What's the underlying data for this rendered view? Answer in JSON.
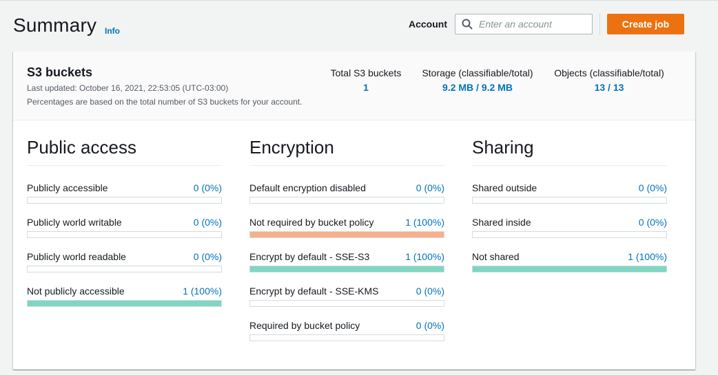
{
  "header": {
    "title": "Summary",
    "info_label": "Info",
    "account_label": "Account",
    "search_placeholder": "Enter an account",
    "search_value": "",
    "create_job_label": "Create job"
  },
  "summary": {
    "title": "S3 buckets",
    "last_updated": "Last updated: October 16, 2021, 22:53:05 (UTC-03:00)",
    "note": "Percentages are based on the total number of S3 buckets for your account.",
    "stats": [
      {
        "label": "Total S3 buckets",
        "value": "1"
      },
      {
        "label": "Storage (classifiable/total)",
        "value": "9.2 MB / 9.2 MB"
      },
      {
        "label": "Objects (classifiable/total)",
        "value": "13 / 13"
      }
    ]
  },
  "colors": {
    "accent_link": "#0073bb",
    "primary_button": "#ec7211",
    "bar_teal": "#7ed6c3",
    "bar_orange": "#f7b089",
    "bar_border": "#d5dbdb"
  },
  "public_access": {
    "heading": "Public access",
    "items": [
      {
        "label": "Publicly accessible",
        "value": "0 (0%)",
        "fraction": 0,
        "color": "#7ed6c3"
      },
      {
        "label": "Publicly world writable",
        "value": "0 (0%)",
        "fraction": 0,
        "color": "#7ed6c3"
      },
      {
        "label": "Publicly world readable",
        "value": "0 (0%)",
        "fraction": 0,
        "color": "#7ed6c3"
      },
      {
        "label": "Not publicly accessible",
        "value": "1 (100%)",
        "fraction": 1,
        "color": "#7ed6c3"
      }
    ]
  },
  "encryption": {
    "heading": "Encryption",
    "items": [
      {
        "label": "Default encryption disabled",
        "value": "0 (0%)",
        "fraction": 0,
        "color": "#7ed6c3"
      },
      {
        "label": "Not required by bucket policy",
        "value": "1 (100%)",
        "fraction": 1,
        "color": "#f7b089"
      },
      {
        "label": "Encrypt by default - SSE-S3",
        "value": "1 (100%)",
        "fraction": 1,
        "color": "#7ed6c3"
      },
      {
        "label": "Encrypt by default - SSE-KMS",
        "value": "0 (0%)",
        "fraction": 0,
        "color": "#7ed6c3"
      },
      {
        "label": "Required by bucket policy",
        "value": "0 (0%)",
        "fraction": 0,
        "color": "#7ed6c3"
      }
    ]
  },
  "sharing": {
    "heading": "Sharing",
    "items": [
      {
        "label": "Shared outside",
        "value": "0 (0%)",
        "fraction": 0,
        "color": "#7ed6c3"
      },
      {
        "label": "Shared inside",
        "value": "0 (0%)",
        "fraction": 0,
        "color": "#7ed6c3"
      },
      {
        "label": "Not shared",
        "value": "1 (100%)",
        "fraction": 1,
        "color": "#7ed6c3"
      }
    ]
  }
}
